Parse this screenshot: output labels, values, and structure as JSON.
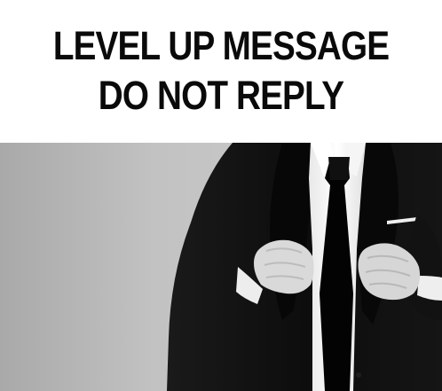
{
  "caption": {
    "text": "LEVEL UP MESSAGE DO NOT REPLY"
  },
  "photo": {
    "subject": "man in black suit adjusting jacket lapels",
    "icon": "person-in-suit-image",
    "colors": {
      "background": "#c9c9c9",
      "suit": "#111111",
      "shirt": "#f2f2f2",
      "tie": "#050505",
      "skin": "#dcdcdc"
    }
  }
}
